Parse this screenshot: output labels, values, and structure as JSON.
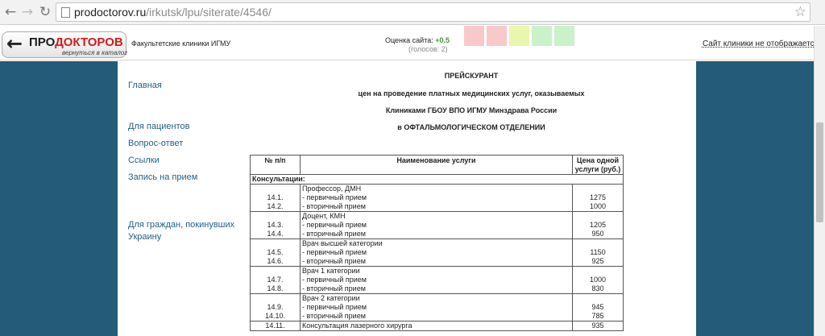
{
  "browser": {
    "url_domain": "prodoctorov.ru",
    "url_path": "/irkutsk/lpu/siterate/4546/"
  },
  "header": {
    "logo_text_black": "ПРО",
    "logo_text_red": "ДОКТОРОВ",
    "logo_sub": "вернуться в каталог",
    "clinic_name": "Факультетские клиники ИГМУ",
    "rating_label": "Оценка сайта:",
    "rating_value": "+0.5",
    "votes": "(голосов: 2)",
    "rate_colors": [
      "#f9c8c8",
      "#f9c8c8",
      "#e9f7ae",
      "#c9f2c9",
      "#c9f2c9"
    ],
    "not_shown": "Сайт клиники не отображается"
  },
  "menu": [
    "Главная",
    "Для пациентов",
    "Вопрос-ответ",
    "Ссылки",
    "Запись на прием",
    "Для граждан, покинувших",
    "Украину"
  ],
  "document": {
    "title": "ПРЕЙСКУРАНТ",
    "line1": "цен  на проведение платных медицинских услуг, оказываемых",
    "line2": "Клиниками ГБОУ ВПО ИГМУ Минздрава России",
    "line3": "в ОФТАЛЬМОЛОГИЧЕСКОМ ОТДЕЛЕНИИ"
  },
  "table": {
    "headers": [
      "№ п/п",
      "Наименование услуги",
      "Цена одной услуги (руб.)"
    ],
    "category": "Консультации:",
    "groups": [
      {
        "title": "Профессор, ДМН",
        "rows": [
          [
            "14.1.",
            "- первичный прием",
            "1275"
          ],
          [
            "14.2.",
            "- вторичный прием",
            "1000"
          ]
        ]
      },
      {
        "title": "Доцент, КМН",
        "rows": [
          [
            "14.3.",
            "- первичный прием",
            "1205"
          ],
          [
            "14.4.",
            "- вторичный прием",
            "950"
          ]
        ]
      },
      {
        "title": "Врач высшей категории",
        "rows": [
          [
            "14.5.",
            "- первичный прием",
            "1150"
          ],
          [
            "14.6.",
            "- вторичный прием",
            "925"
          ]
        ]
      },
      {
        "title": "Врач 1 категории",
        "rows": [
          [
            "14.7.",
            "- первичный прием",
            "1000"
          ],
          [
            "14.8.",
            "- вторичный прием",
            "830"
          ]
        ]
      },
      {
        "title": "Врач 2 категории",
        "rows": [
          [
            "14.9.",
            "- первичный прием",
            "945"
          ],
          [
            "14.10.",
            "- вторичный прием",
            "785"
          ]
        ]
      }
    ],
    "last_row": [
      "14.11.",
      "Консультация лазерного хирурга",
      "935"
    ]
  }
}
